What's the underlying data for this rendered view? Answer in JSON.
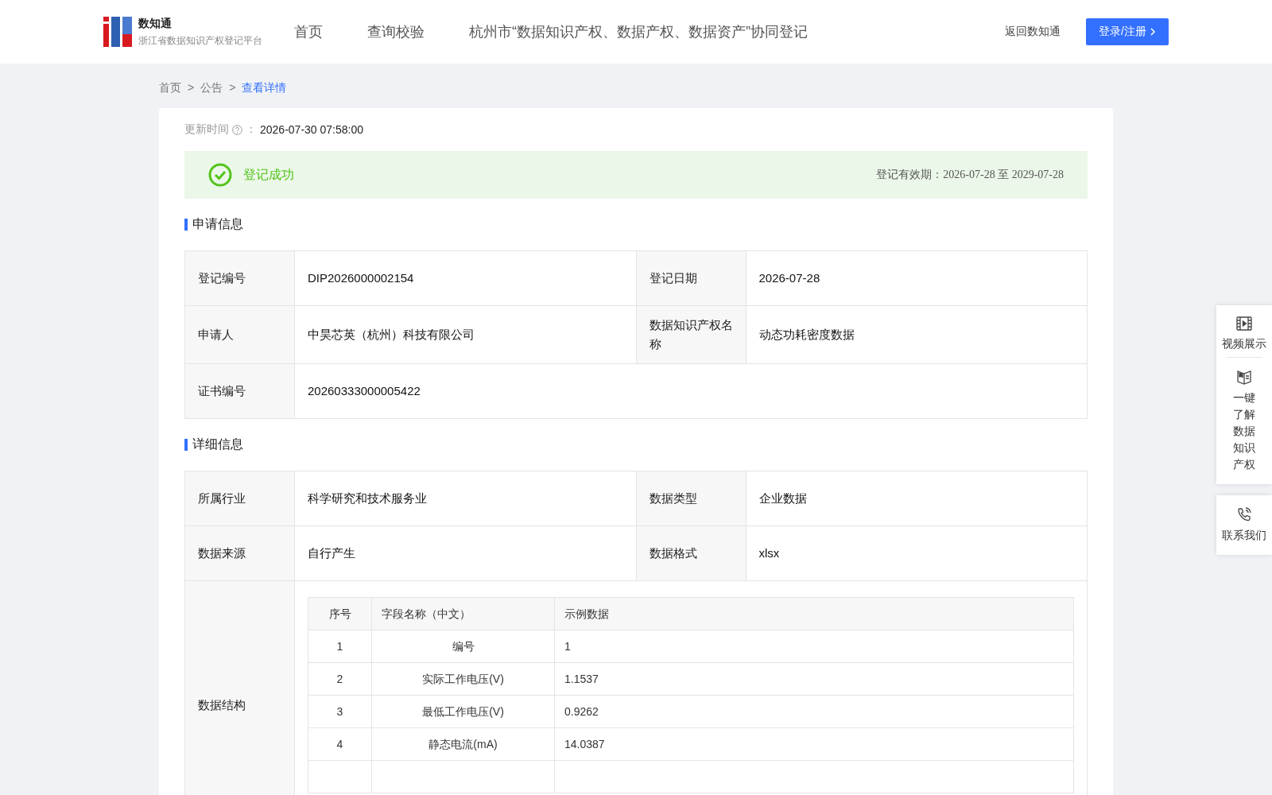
{
  "header": {
    "logo_title": "数知通",
    "logo_subtitle": "浙江省数据知识产权登记平台",
    "nav": [
      {
        "label": "首页"
      },
      {
        "label": "查询校验"
      },
      {
        "label": "杭州市“数据知识产权、数据产权、数据资产”协同登记"
      }
    ],
    "back_link": "返回数知通",
    "login_button": "登录/注册"
  },
  "breadcrumb": [
    {
      "label": "首页",
      "selected": false
    },
    {
      "label": "公告",
      "selected": false
    },
    {
      "label": "查看详情",
      "selected": true
    }
  ],
  "breadcrumb_separator": ">",
  "update": {
    "label": "更新时间",
    "separator": "：",
    "value": "2026-07-30 07:58:00"
  },
  "status": {
    "text": "登记成功",
    "validity": "登记有效期：2026-07-28 至 2029-07-28"
  },
  "sections": [
    {
      "title": "申请信息",
      "rows": [
        [
          {
            "label": "登记编号",
            "value": "DIP2026000002154"
          },
          {
            "label": "登记日期",
            "value": "2026-07-28"
          }
        ],
        [
          {
            "label": "申请人",
            "value": "中昊芯英（杭州）科技有限公司"
          },
          {
            "label": "数据知识产权名称",
            "value": "动态功耗密度数据"
          }
        ],
        [
          {
            "label": "证书编号",
            "value": "20260333000005422"
          }
        ]
      ]
    },
    {
      "title": "详细信息",
      "rows": [
        [
          {
            "label": "所属行业",
            "value": "科学研究和技术服务业"
          },
          {
            "label": "数据类型",
            "value": "企业数据"
          }
        ],
        [
          {
            "label": "数据来源",
            "value": "自行产生"
          },
          {
            "label": "数据格式",
            "value": "xlsx"
          }
        ],
        [
          {
            "label": "数据结构",
            "table": {
              "columns": [
                "序号",
                "字段名称（中文）",
                "示例数据"
              ],
              "rows": [
                [
                  "1",
                  "编号",
                  "1"
                ],
                [
                  "2",
                  "实际工作电压(V)",
                  "1.1537"
                ],
                [
                  "3",
                  "最低工作电压(V)",
                  "0.9262"
                ],
                [
                  "4",
                  "静态电流(mA)",
                  "14.0387"
                ]
              ]
            }
          }
        ]
      ]
    }
  ],
  "side_panel": [
    [
      {
        "kind": "video",
        "label": "视频展示"
      },
      {
        "kind": "book",
        "label": "一键了解数据知识产权"
      }
    ],
    [
      {
        "kind": "phone",
        "label": "联系我们"
      }
    ]
  ]
}
